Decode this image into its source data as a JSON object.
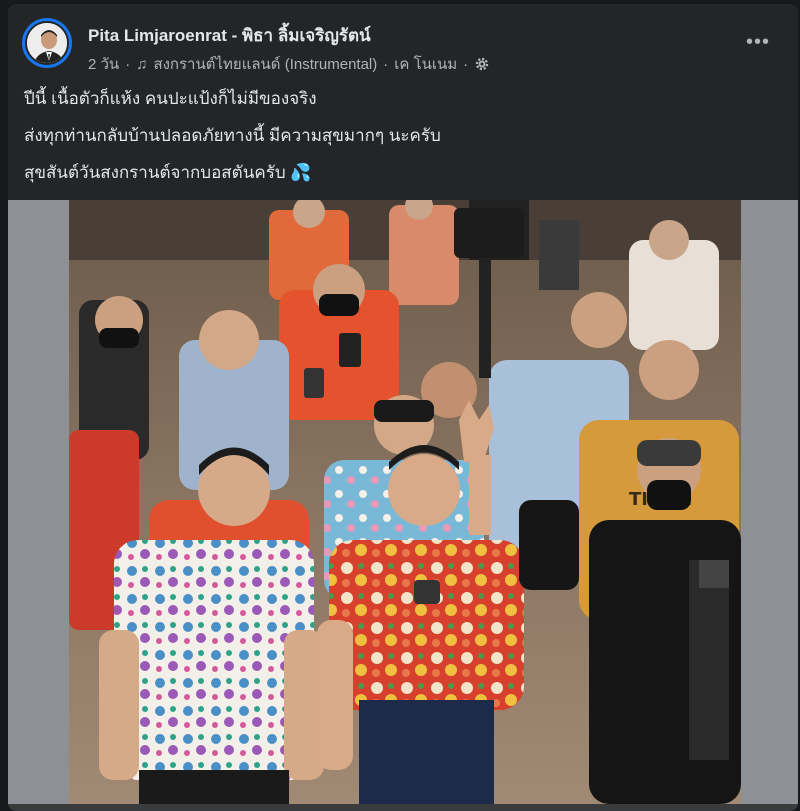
{
  "post": {
    "author": "Pita Limjaroenrat - พิธา ลิ้มเจริญรัตน์",
    "time": "2 วัน",
    "music": "สงกรานต์ไทยแลนด์ (Instrumental)",
    "artist": "เค โนเนม",
    "more_label": "•••",
    "lines": [
      "ปีนี้ เนื้อตัวก็แห้ง คนปะแป้งก็ไม่มีของจริง",
      "ส่งทุกท่านกลับบ้านปลอดภัยทางนี้ มีความสุขมากๆ นะครับ",
      "สุขสันต์วันสงกรานต์จากบอสตันครับ 💦"
    ]
  },
  "photo": {
    "shirt_print": "TIMBE"
  },
  "icons": {
    "music": "music-note-icon",
    "privacy": "gear-icon",
    "more": "more-horizontal-icon"
  },
  "colors": {
    "background": "#18191a",
    "card": "#242526",
    "text": "#e4e6eb",
    "secondary": "#b0b3b8",
    "accent": "#1877f2"
  }
}
